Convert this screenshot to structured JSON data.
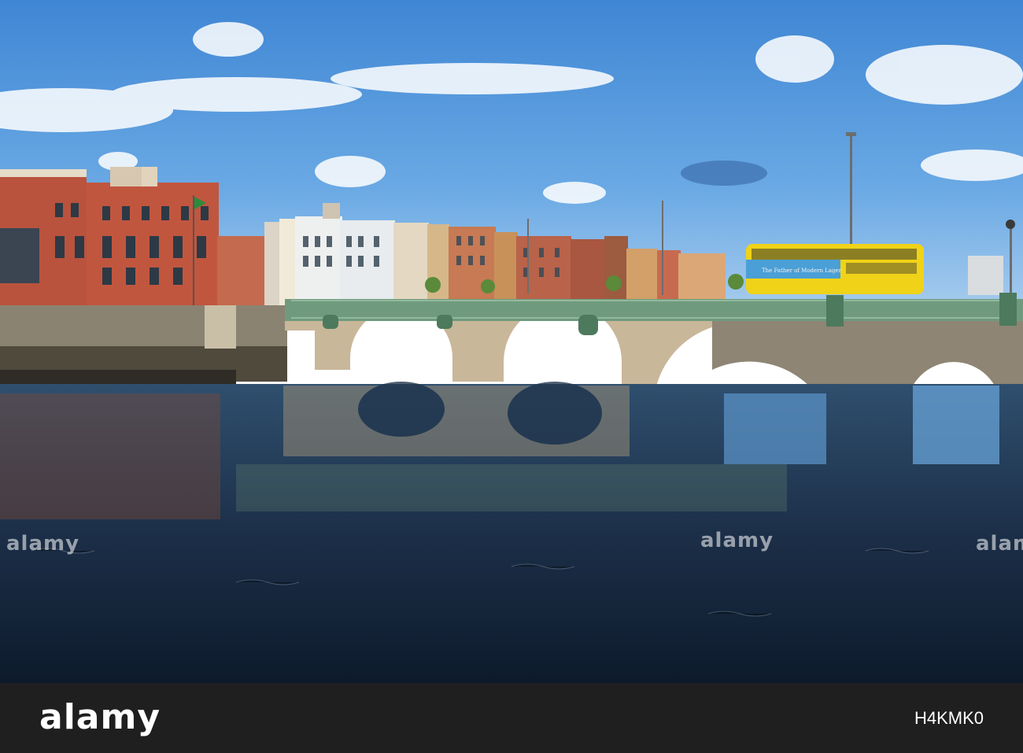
{
  "photo": {
    "subject": "stone arch bridge over a river with a double-decker bus and terraced buildings",
    "bus_banner": "The Father of Modern Lager"
  },
  "watermarks": [
    "alamy",
    "alamy",
    "alamy"
  ],
  "footer": {
    "logo": "alamy",
    "image_id": "H4KMK0"
  }
}
